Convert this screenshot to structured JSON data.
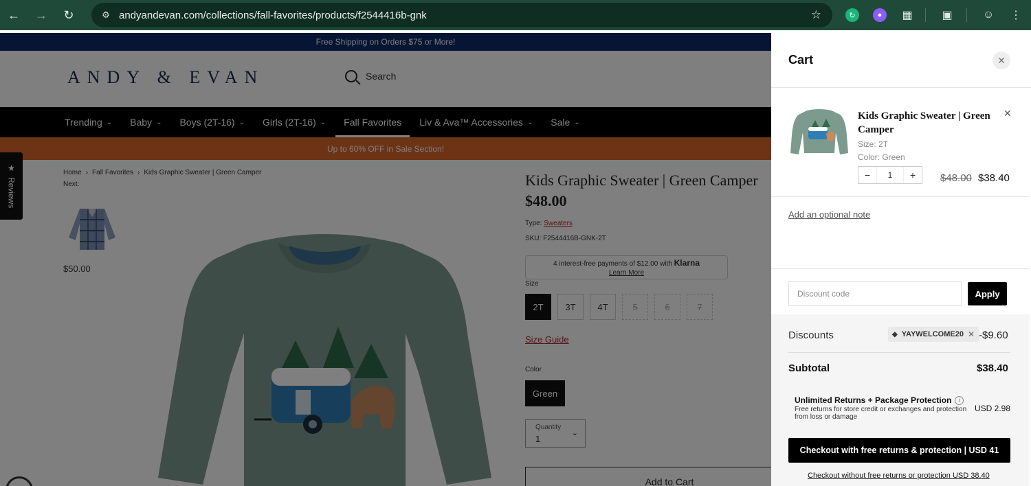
{
  "browser": {
    "url": "andyandevan.com/collections/fall-favorites/products/f2544416b-gnk"
  },
  "site": {
    "shipping_banner": "Free Shipping on Orders $75 or More!",
    "logo": "ANDY & EVAN",
    "search_label": "Search",
    "nav": [
      {
        "label": "Trending"
      },
      {
        "label": "Baby"
      },
      {
        "label": "Boys (2T-16)"
      },
      {
        "label": "Girls (2T-16)"
      },
      {
        "label": "Fall Favorites"
      },
      {
        "label": "Liv & Ava™ Accessories"
      },
      {
        "label": "Sale"
      }
    ],
    "sale_banner": "Up to 60% OFF in Sale Section!",
    "reviews_tab": "Reviews"
  },
  "product": {
    "breadcrumb": [
      "Home",
      "Fall Favorites",
      "Kids Graphic Sweater | Green Camper"
    ],
    "next_label": "Next:",
    "next_price": "$50.00",
    "title": "Kids Graphic Sweater | Green Camper",
    "price": "$48.00",
    "type_label": "Type:",
    "type_value": "Sweaters",
    "sku": "SKU: F2544416B-GNK-2T",
    "klarna_text": "4 interest-free payments of $12.00 with",
    "klarna_brand": "Klarna",
    "klarna_learn": "Learn More",
    "size_label": "Size",
    "sizes": [
      "2T",
      "3T",
      "4T",
      "5",
      "6",
      "7"
    ],
    "size_guide": "Size Guide",
    "color_label": "Color",
    "color_value": "Green",
    "quantity_label": "Quantity",
    "quantity_value": "1",
    "add_to_cart": "Add to Cart"
  },
  "cart": {
    "title": "Cart",
    "item": {
      "name": "Kids Graphic Sweater | Green Camper",
      "size": "Size: 2T",
      "color": "Color: Green",
      "qty": "1",
      "old_price": "$48.00",
      "new_price": "$38.40"
    },
    "note_link": "Add an optional note",
    "discount_placeholder": "Discount code",
    "apply": "Apply",
    "discounts_label": "Discounts",
    "discount_code": "YAYWELCOME20",
    "discount_amount": "-$9.60",
    "subtotal_label": "Subtotal",
    "subtotal": "$38.40",
    "protection_title": "Unlimited Returns + Package Protection",
    "protection_desc": "Free returns for store credit or exchanges and protection from loss or damage",
    "protection_price": "USD 2.98",
    "checkout": "Checkout with free returns & protection | USD 41",
    "checkout_alt": "Checkout without free returns or protection USD 38.40"
  },
  "colors": {
    "browser_chrome": "#1f4a3a",
    "navy_banner": "#0b2a66",
    "sale_banner": "#d9672a",
    "accent_red": "#b0282d"
  }
}
